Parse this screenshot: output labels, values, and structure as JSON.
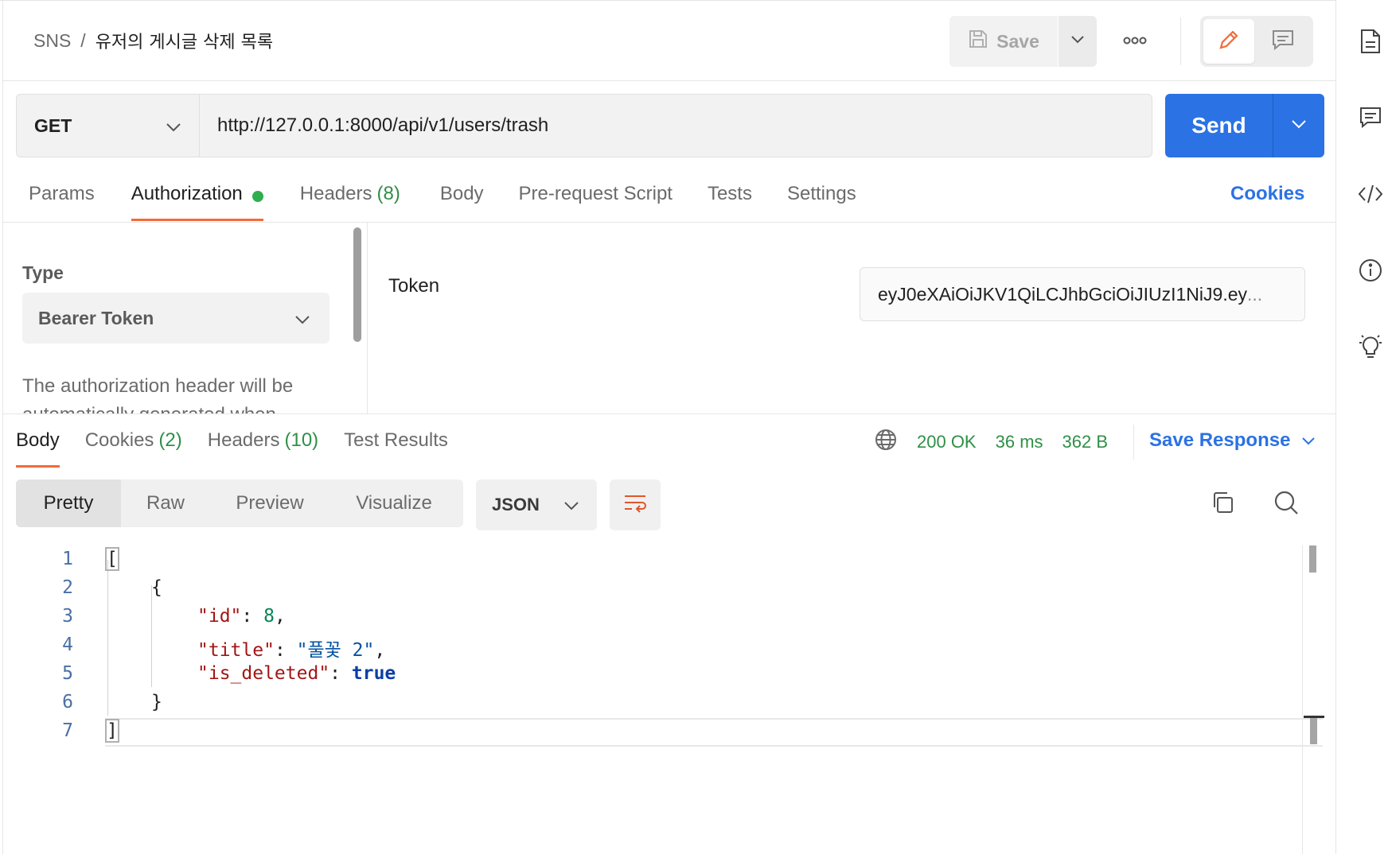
{
  "header": {
    "breadcrumb_parent": "SNS",
    "breadcrumb_sep": "/",
    "breadcrumb_current": "유저의 게시글 삭제 목록",
    "save_label": "Save",
    "more_icon": "ooo"
  },
  "request": {
    "method": "GET",
    "url": "http://127.0.0.1:8000/api/v1/users/trash",
    "send_label": "Send"
  },
  "request_tabs": {
    "params": "Params",
    "authorization": "Authorization",
    "headers": "Headers",
    "headers_count": "(8)",
    "body": "Body",
    "prerequest": "Pre-request Script",
    "tests": "Tests",
    "settings": "Settings",
    "cookies": "Cookies"
  },
  "auth": {
    "type_label": "Type",
    "type_value": "Bearer Token",
    "description": "The authorization header will be automatically generated when",
    "token_label": "Token",
    "token_value": "eyJ0eXAiOiJKV1QiLCJhbGciOiJIUzI1NiJ9.ey",
    "token_ellipsis": "..."
  },
  "response_tabs": {
    "body": "Body",
    "cookies": "Cookies",
    "cookies_count": "(2)",
    "headers": "Headers",
    "headers_count": "(10)",
    "test_results": "Test Results"
  },
  "response_status": {
    "status": "200 OK",
    "time": "36 ms",
    "size": "362 B",
    "save_response": "Save Response"
  },
  "view": {
    "pretty": "Pretty",
    "raw": "Raw",
    "preview": "Preview",
    "visualize": "Visualize",
    "format": "JSON"
  },
  "code": {
    "line_numbers": [
      "1",
      "2",
      "3",
      "4",
      "5",
      "6",
      "7"
    ],
    "open_bracket": "[",
    "open_brace": "{",
    "key_id": "\"id\"",
    "val_id": "8",
    "key_title": "\"title\"",
    "val_title": "\"풀꽃 2\"",
    "key_deleted": "\"is_deleted\"",
    "val_deleted": "true",
    "close_brace": "}",
    "close_bracket": "]",
    "colon": ": ",
    "comma": ","
  },
  "colors": {
    "accent_blue": "#2b72e4",
    "tab_underline": "#f26b3a",
    "status_green": "#2f8f46"
  }
}
